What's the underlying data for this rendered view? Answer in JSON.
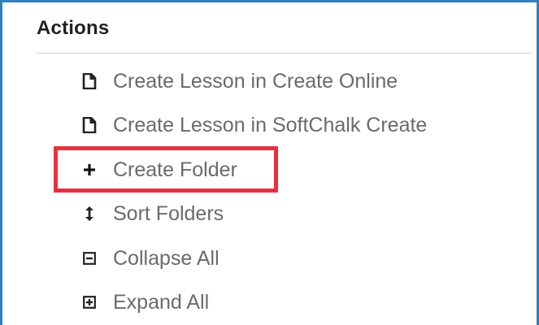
{
  "panel": {
    "title": "Actions"
  },
  "actions": [
    {
      "label": "Create Lesson in Create Online",
      "icon": "document-icon"
    },
    {
      "label": "Create Lesson in SoftChalk Create",
      "icon": "document-icon"
    },
    {
      "label": "Create Folder",
      "icon": "plus-icon",
      "highlighted": true
    },
    {
      "label": "Sort Folders",
      "icon": "sort-icon"
    },
    {
      "label": "Collapse All",
      "icon": "collapse-icon"
    },
    {
      "label": "Expand All",
      "icon": "expand-icon"
    }
  ],
  "colors": {
    "frame_border": "#2f7fc1",
    "highlight_border": "#e8313c",
    "label_text": "#6a6a6a",
    "title_text": "#222222"
  }
}
